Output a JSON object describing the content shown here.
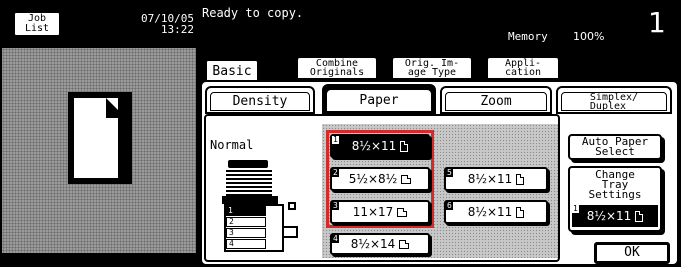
{
  "header": {
    "job_list_label": "Job\nList",
    "date": "07/10/05",
    "time": "13:22",
    "status": "Ready to copy.",
    "memory_label": "Memory",
    "memory_value": "100%",
    "copy_count": "1"
  },
  "top_tabs": [
    {
      "label": "Basic",
      "active": true
    },
    {
      "label": "Combine\nOriginals",
      "active": false
    },
    {
      "label": "Orig. Im-\nage Type",
      "active": false
    },
    {
      "label": "Appli-\ncation",
      "active": false
    }
  ],
  "sub_tabs": [
    {
      "label": "Density",
      "active": false
    },
    {
      "label": "Paper",
      "active": true
    },
    {
      "label": "Zoom",
      "active": false
    },
    {
      "label": "Simplex/\nDuplex",
      "active": false
    }
  ],
  "paper_panel": {
    "mode_label": "Normal",
    "machine_tray_numbers": [
      "1",
      "2",
      "3",
      "4"
    ],
    "trays": [
      {
        "num": "1",
        "label": "8½×11",
        "orientation": "portrait",
        "selected": true
      },
      {
        "num": "2",
        "label": "5½×8½",
        "orientation": "landscape",
        "selected": false
      },
      {
        "num": "3",
        "label": "11×17",
        "orientation": "landscape",
        "selected": false
      },
      {
        "num": "4",
        "label": "8½×14",
        "orientation": "landscape",
        "selected": false
      },
      {
        "num": "5",
        "label": "8½×11",
        "orientation": "portrait",
        "selected": false
      },
      {
        "num": "6",
        "label": "8½×11",
        "orientation": "portrait",
        "selected": false
      }
    ]
  },
  "right_buttons": {
    "auto_paper": "Auto Paper\nSelect",
    "change_tray": "Change\nTray\nSettings",
    "current_tray_num": "1",
    "current_tray_label": "8½×11",
    "ok": "OK"
  },
  "colors": {
    "highlight": "#d42a2a",
    "background": "#000000",
    "panel": "#ffffff"
  }
}
